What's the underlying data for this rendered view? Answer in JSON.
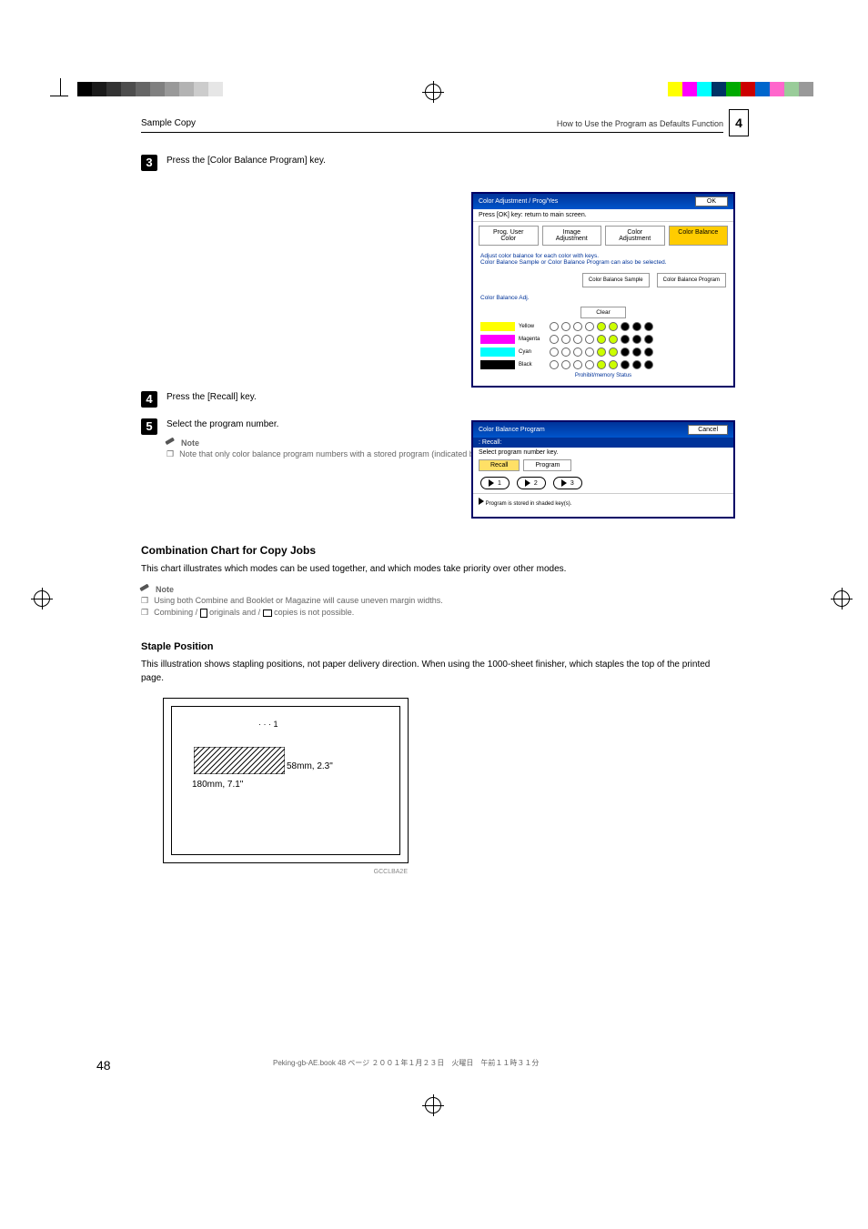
{
  "header": {
    "left": "Sample Copy",
    "right": "How to Use the Program as Defaults Function"
  },
  "page_number": "4",
  "steps": {
    "s3_num": "3",
    "s3_text": "Press the [Color Balance Program] key.",
    "s4_num": "4",
    "s4_text": "Press the [Recall] key.",
    "s5_num": "5",
    "s5_text": "Select the program number."
  },
  "note1": {
    "label": "Note",
    "bullet": "Note that only color balance program numbers with a stored program (indicated by the      mark) can be used with this function."
  },
  "section": {
    "title": "Combination Chart for Copy Jobs",
    "para": "This chart illustrates which modes can be used together, and which modes take priority over other modes."
  },
  "note2": {
    "label": "Note",
    "line1": "Using both Combine and Booklet or Magazine will cause uneven margin widths.",
    "line2a": "Combining     / ",
    "line2b": " originals and     / ",
    "line2c": " copies is not possible."
  },
  "subsection": {
    "title": "Staple Position",
    "para": "This illustration shows stapling positions, not paper delivery direction. When using the 1000-sheet finisher, which staples the top of the printed page.",
    "staple_marker": "1",
    "dim1": "58mm, 2.3\"",
    "dim2": "180mm, 7.1\"",
    "diag_id": "GCCLBA2E"
  },
  "screenshot1": {
    "title": "Color Adjustment / Prog/Yes",
    "ok": "OK",
    "sub": "Press [OK] key: return to main screen.",
    "tabs": {
      "t1": "Prog. User Color",
      "t2": "Image Adjustment",
      "t3": "Color Adjustment",
      "t4": "Color Balance"
    },
    "desc1": "Adjust color balance for each color with keys.",
    "desc2": "Color Balance Sample or Color Balance Program can also be selected.",
    "btn1": "Color Balance Sample",
    "btn2": "Color Balance Program",
    "section_label": "Color Balance Adj.",
    "clear": "Clear",
    "colors": {
      "yellow": "Yellow",
      "magenta": "Magenta",
      "cyan": "Cyan",
      "black": "Black"
    },
    "status": "Prohibit/memory Status"
  },
  "screenshot2": {
    "title": "Color Balance Program",
    "cancel": "Cancel",
    "sub": ": Recall:",
    "desc": "Select program number key.",
    "tab_recall": "Recall",
    "tab_program": "Program",
    "p1": "1",
    "p2": "2",
    "p3": "3",
    "footer": "Program is stored in shaded key(s)."
  },
  "footer": {
    "page": "48",
    "file": "Peking-gb-AE.book  48 ページ  ２００１年１月２３日　火曜日　午前１１時３１分"
  }
}
